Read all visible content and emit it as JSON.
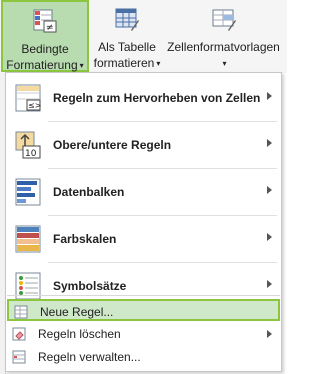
{
  "ribbon": {
    "buttons": [
      {
        "line1": "Bedingte",
        "line2": "Formatierung",
        "icon": "conditional-formatting-icon"
      },
      {
        "line1": "Als Tabelle",
        "line2": "formatieren",
        "icon": "format-as-table-icon"
      },
      {
        "line1": "Zellenformatvorlagen",
        "line2": "",
        "icon": "cell-styles-icon"
      }
    ]
  },
  "menu": {
    "items": [
      {
        "label": "Regeln zum Hervorheben von Zellen",
        "icon": "highlight-cells-rules-icon",
        "submenu": true
      },
      {
        "label": "Obere/untere Regeln",
        "icon": "top-bottom-rules-icon",
        "submenu": true
      },
      {
        "label": "Datenbalken",
        "icon": "data-bars-icon",
        "submenu": true
      },
      {
        "label": "Farbskalen",
        "icon": "color-scales-icon",
        "submenu": true
      },
      {
        "label": "Symbolsätze",
        "icon": "icon-sets-icon",
        "submenu": true
      }
    ],
    "small_items": [
      {
        "label": "Neue Regel...",
        "icon": "new-rule-icon",
        "highlighted": true
      },
      {
        "label": "Regeln löschen",
        "icon": "clear-rules-icon",
        "submenu": true
      },
      {
        "label": "Regeln verwalten...",
        "icon": "manage-rules-icon"
      }
    ]
  },
  "colors": {
    "highlight_fill": "#b8dcb0",
    "highlight_border": "#8cc63f"
  }
}
